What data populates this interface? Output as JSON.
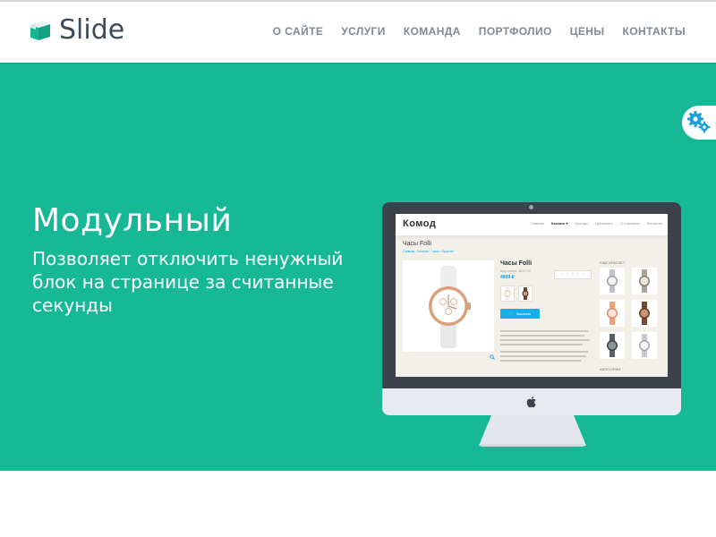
{
  "brand": {
    "name": "Slide",
    "accent_color": "#16b896",
    "logo_icon": "box-logo-icon"
  },
  "nav": {
    "items": [
      "О САЙТЕ",
      "УСЛУГИ",
      "КОМАНДА",
      "ПОРТФОЛИО",
      "ЦЕНЫ",
      "КОНТАКТЫ"
    ]
  },
  "settings": {
    "icon": "gear-icon"
  },
  "hero": {
    "title": "Модульный",
    "subtitle": "Позволяет отключить ненужный блок на странице за считанные секунды"
  },
  "mockup": {
    "site_logo": "Комод",
    "nav": [
      "Главная",
      "Каталог ▾",
      "Бренды",
      "Где купить",
      "О компании",
      "Контакты"
    ],
    "page_title": "Часы Folli",
    "breadcrumbs": "Главная · Каталог · Часы · Браслет",
    "product": {
      "name": "Часы Folli",
      "code": "Код товара: 4837-7/2",
      "price": "4899 ₽",
      "button": "Заказать",
      "rating": "☆☆☆☆☆"
    },
    "sidebar_title": "ЕЩЕ БРАСЛЕТ",
    "sidebar_bottom": "КАТЕГОРИИ"
  }
}
